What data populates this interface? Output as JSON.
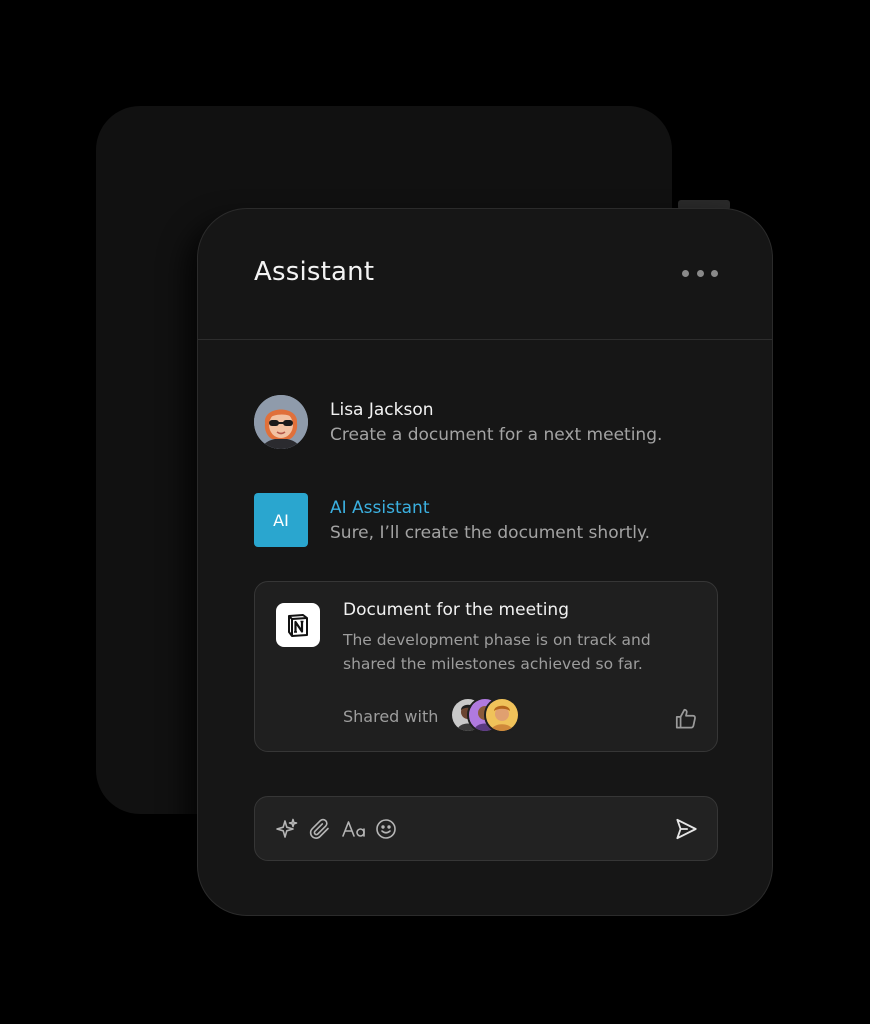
{
  "header": {
    "title": "Assistant",
    "more_icon": "more-horizontal-icon"
  },
  "messages": [
    {
      "name": "Lisa Jackson",
      "text": "Create a document for a next meeting.",
      "avatar": "lisa-avatar"
    },
    {
      "name": "AI Assistant",
      "badge": "AI",
      "text": "Sure, I’ll create the document shortly.",
      "accent": "#2aa6cf"
    }
  ],
  "document": {
    "title": "Document for the meeting",
    "description": "The development phase is on track and shared the milestones achieved so far.",
    "shared_label": "Shared with",
    "app_icon": "notion-icon",
    "like_icon": "thumbs-up-icon"
  },
  "composer": {
    "tools": [
      "sparkle-icon",
      "paperclip-icon",
      "text-format-icon",
      "emoji-icon"
    ],
    "send_icon": "send-icon"
  },
  "colors": {
    "accent": "#2aa6cf",
    "panel": "#161616",
    "card": "#1f1f1f"
  }
}
